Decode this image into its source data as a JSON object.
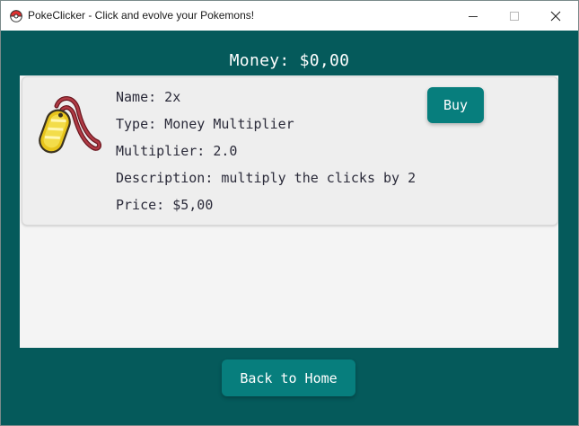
{
  "window": {
    "title": "PokeClicker - Click and evolve your Pokemons!",
    "app_icon": "pokeball-icon",
    "controls": {
      "minimize_icon": "minimize-icon",
      "maximize_icon": "maximize-icon",
      "close_icon": "close-icon"
    }
  },
  "header": {
    "money_label": "Money: $0,00"
  },
  "shop": {
    "items": [
      {
        "icon": "amulet-coin-icon",
        "name": "Name: 2x",
        "type": "Type: Money Multiplier",
        "multiplier": "Multiplier: 2.0",
        "description": "Description: multiply the clicks by 2",
        "price": "Price: $5,00",
        "buy_label": "Buy"
      }
    ]
  },
  "footer": {
    "back_label": "Back to Home"
  },
  "colors": {
    "background": "#055a5b",
    "button": "#077e7d",
    "panel": "#f4f4f4",
    "card": "#eeeeee",
    "text": "#2b2b3a"
  }
}
